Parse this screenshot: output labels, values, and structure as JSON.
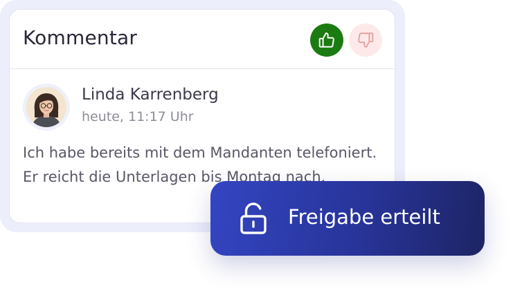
{
  "comment_card": {
    "title": "Kommentar",
    "vote_up_state": "active",
    "vote_down_state": "inactive",
    "colors": {
      "vote_up_bg": "#1c7a12",
      "vote_down_bg": "#fde9e9",
      "vote_down_icon": "#e4a3a3"
    },
    "icons": {
      "vote_up": "thumbs-up-icon",
      "vote_down": "thumbs-down-icon"
    }
  },
  "comment": {
    "author_name": "Linda Karrenberg",
    "timestamp": "heute, 11:17 Uhr",
    "text": "Ich habe bereits mit dem Mandanten telefoniert. Er reicht die Unterlagen bis Montag nach."
  },
  "approval_button": {
    "label": "Freigabe erteilt",
    "icon": "unlock-icon",
    "colors": {
      "gradient_start": "#3345c2",
      "gradient_end": "#1d2464"
    }
  }
}
